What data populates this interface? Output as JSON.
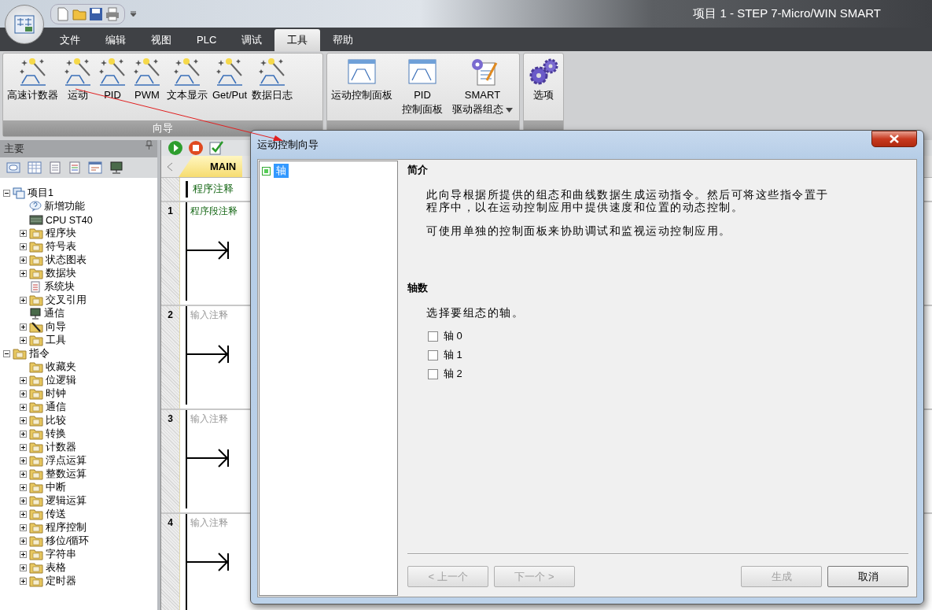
{
  "window": {
    "title": "项目 1 - STEP 7-Micro/WIN SMART"
  },
  "menu_tabs": [
    {
      "label": "文件",
      "selected": false
    },
    {
      "label": "编辑",
      "selected": false
    },
    {
      "label": "视图",
      "selected": false
    },
    {
      "label": "PLC",
      "selected": false
    },
    {
      "label": "调试",
      "selected": false
    },
    {
      "label": "工具",
      "selected": true
    },
    {
      "label": "帮助",
      "selected": false
    }
  ],
  "ribbon": {
    "groups": [
      {
        "label": "向导",
        "buttons": [
          {
            "kind": "wizard",
            "lines": [
              "高速计数器"
            ]
          },
          {
            "kind": "wizard",
            "lines": [
              "运动"
            ]
          },
          {
            "kind": "wizard",
            "lines": [
              "PID"
            ]
          },
          {
            "kind": "wizard",
            "lines": [
              "PWM"
            ]
          },
          {
            "kind": "wizard",
            "lines": [
              "文本显示"
            ]
          },
          {
            "kind": "wizard",
            "lines": [
              "Get/Put"
            ]
          },
          {
            "kind": "wizard",
            "lines": [
              "数据日志"
            ]
          }
        ]
      },
      {
        "buttons": [
          {
            "kind": "panel",
            "lines": [
              "运动控制面板"
            ]
          },
          {
            "kind": "panel",
            "lines": [
              "PID",
              "控制面板"
            ]
          },
          {
            "kind": "config",
            "lines": [
              "SMART",
              "驱动器组态"
            ],
            "dropdown": true
          }
        ]
      },
      {
        "buttons": [
          {
            "kind": "settings",
            "lines": [
              "选项"
            ]
          }
        ]
      }
    ]
  },
  "project_panel": {
    "title": "主要",
    "tree": [
      {
        "label": "项目1",
        "kind": "project",
        "expanded": true,
        "children": [
          {
            "label": "新增功能",
            "kind": "help"
          },
          {
            "label": "CPU ST40",
            "kind": "cpu"
          },
          {
            "label": "程序块",
            "kind": "folder",
            "expanded": false
          },
          {
            "label": "符号表",
            "kind": "folder",
            "expanded": false
          },
          {
            "label": "状态图表",
            "kind": "folder",
            "expanded": false
          },
          {
            "label": "数据块",
            "kind": "folder",
            "expanded": false
          },
          {
            "label": "系统块",
            "kind": "doc"
          },
          {
            "label": "交叉引用",
            "kind": "folder",
            "expanded": false
          },
          {
            "label": "通信",
            "kind": "monitor"
          },
          {
            "label": "向导",
            "kind": "wand",
            "expanded": false
          },
          {
            "label": "工具",
            "kind": "folder",
            "expanded": false
          }
        ]
      },
      {
        "label": "指令",
        "kind": "folder",
        "expanded": true,
        "children": [
          {
            "label": "收藏夹",
            "kind": "folder"
          },
          {
            "label": "位逻辑",
            "kind": "folder",
            "expanded": false
          },
          {
            "label": "时钟",
            "kind": "folder",
            "expanded": false
          },
          {
            "label": "通信",
            "kind": "folder",
            "expanded": false
          },
          {
            "label": "比较",
            "kind": "folder",
            "expanded": false
          },
          {
            "label": "转换",
            "kind": "folder",
            "expanded": false
          },
          {
            "label": "计数器",
            "kind": "folder",
            "expanded": false
          },
          {
            "label": "浮点运算",
            "kind": "folder",
            "expanded": false
          },
          {
            "label": "整数运算",
            "kind": "folder",
            "expanded": false
          },
          {
            "label": "中断",
            "kind": "folder",
            "expanded": false
          },
          {
            "label": "逻辑运算",
            "kind": "folder",
            "expanded": false
          },
          {
            "label": "传送",
            "kind": "folder",
            "expanded": false
          },
          {
            "label": "程序控制",
            "kind": "folder",
            "expanded": false
          },
          {
            "label": "移位/循环",
            "kind": "folder",
            "expanded": false
          },
          {
            "label": "字符串",
            "kind": "folder",
            "expanded": false
          },
          {
            "label": "表格",
            "kind": "folder",
            "expanded": false
          },
          {
            "label": "定时器",
            "kind": "folder",
            "expanded": false
          }
        ]
      }
    ]
  },
  "editor": {
    "tab": "MAIN",
    "program_comment": "程序注释",
    "networks": [
      {
        "number": "1",
        "comment": "程序段注释",
        "kind": "comment"
      },
      {
        "number": "2",
        "comment": "输入注释",
        "kind": "placeholder"
      },
      {
        "number": "3",
        "comment": "输入注释",
        "kind": "placeholder"
      },
      {
        "number": "4",
        "comment": "输入注释",
        "kind": "placeholder"
      }
    ]
  },
  "dialog": {
    "title": "运动控制向导",
    "nav": [
      {
        "label": "轴",
        "selected": true
      }
    ],
    "sections": [
      {
        "heading": "简介",
        "paragraphs": [
          "此向导根据所提供的组态和曲线数据生成运动指令。然后可将这些指令置于程序中，以在运动控制应用中提供速度和位置的动态控制。",
          "可使用单独的控制面板来协助调试和监视运动控制应用。"
        ]
      },
      {
        "heading": "轴数",
        "paragraphs": [
          "选择要组态的轴。"
        ],
        "checkboxes": [
          {
            "label": "轴 0",
            "checked": false
          },
          {
            "label": "轴 1",
            "checked": false
          },
          {
            "label": "轴 2",
            "checked": false
          }
        ]
      }
    ],
    "buttons": [
      {
        "label": "< 上一个",
        "disabled": true
      },
      {
        "label": "下一个 >",
        "disabled": true
      },
      {
        "label": "生成",
        "disabled": true
      },
      {
        "label": "取消",
        "disabled": false
      }
    ]
  }
}
